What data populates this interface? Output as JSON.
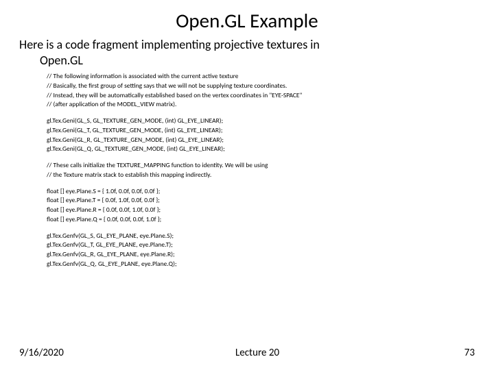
{
  "title": "Open.GL Example",
  "intro_line1": "Here is a code fragment implementing projective textures in",
  "intro_line2": "Open.GL",
  "code": {
    "c1": "// The following information is associated with the current active texture",
    "c2": "// Basically, the first group of setting says that we will not be supplying texture coordinates.",
    "c3": "// Instead, they will be automatically established based on the vertex coordinates in \"EYE-SPACE\"",
    "c4": "// (after application of the MODEL_VIEW matrix).",
    "g1": "gl.Tex.Geni(GL_S, GL_TEXTURE_GEN_MODE, (int) GL_EYE_LINEAR);",
    "g2": "gl.Tex.Geni(GL_T, GL_TEXTURE_GEN_MODE, (int) GL_EYE_LINEAR);",
    "g3": "gl.Tex.Geni(GL_R, GL_TEXTURE_GEN_MODE, (int) GL_EYE_LINEAR);",
    "g4": "gl.Tex.Geni(GL_Q, GL_TEXTURE_GEN_MODE, (int) GL_EYE_LINEAR);",
    "c5": "// These calls initialize the TEXTURE_MAPPING function to identity. We will be using",
    "c6": "// the Texture matrix stack to establish this mapping indirectly.",
    "f1": "float [] eye.Plane.S = { 1.0f, 0.0f, 0.0f, 0.0f };",
    "f2": "float [] eye.Plane.T = { 0.0f, 1.0f, 0.0f, 0.0f };",
    "f3": "float [] eye.Plane.R = { 0.0f, 0.0f, 1.0f, 0.0f };",
    "f4": "float [] eye.Plane.Q = { 0.0f, 0.0f, 0.0f, 1.0f };",
    "h1": "gl.Tex.Genfv(GL_S, GL_EYE_PLANE, eye.Plane.S);",
    "h2": "gl.Tex.Genfv(GL_T, GL_EYE_PLANE, eye.Plane.T);",
    "h3": "gl.Tex.Genfv(GL_R, GL_EYE_PLANE, eye.Plane.R);",
    "h4": "gl.Tex.Genfv(GL_Q, GL_EYE_PLANE, eye.Plane.Q);"
  },
  "footer": {
    "date": "9/16/2020",
    "lecture": "Lecture 20",
    "page": "73"
  }
}
